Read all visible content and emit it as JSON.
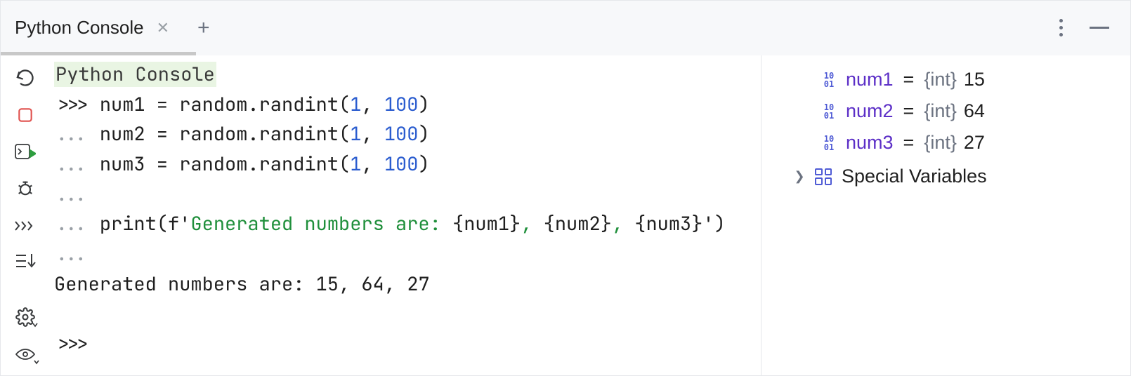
{
  "tabbar": {
    "tab_label": "Python Console"
  },
  "console": {
    "title": "Python Console",
    "lines": [
      {
        "prompt": ">>>",
        "pre": "num1 = random.randint(",
        "a": "1",
        "mid": ", ",
        "b": "100",
        "post": ")"
      },
      {
        "prompt": "...",
        "pre": "num2 = random.randint(",
        "a": "1",
        "mid": ", ",
        "b": "100",
        "post": ")"
      },
      {
        "prompt": "...",
        "pre": "num3 = random.randint(",
        "a": "1",
        "mid": ", ",
        "b": "100",
        "post": ")"
      }
    ],
    "cont_blank": "...",
    "print_prefix": "...",
    "print_open": "print(",
    "print_f": "f",
    "print_quote1": "'",
    "print_str": "Generated numbers are: ",
    "print_brace1": "{num1}",
    "print_sep1": ", ",
    "print_brace2": "{num2}",
    "print_sep2": ", ",
    "print_brace3": "{num3}",
    "print_quote2": "'",
    "print_close": ")",
    "cont_blank2": "...",
    "output": "Generated numbers are: 15, 64, 27",
    "final_prompt": ">>>"
  },
  "variables": {
    "rows": [
      {
        "name": "num1",
        "type": "{int}",
        "value": "15"
      },
      {
        "name": "num2",
        "type": "{int}",
        "value": "64"
      },
      {
        "name": "num3",
        "type": "{int}",
        "value": "27"
      }
    ],
    "special_label": "Special Variables"
  }
}
